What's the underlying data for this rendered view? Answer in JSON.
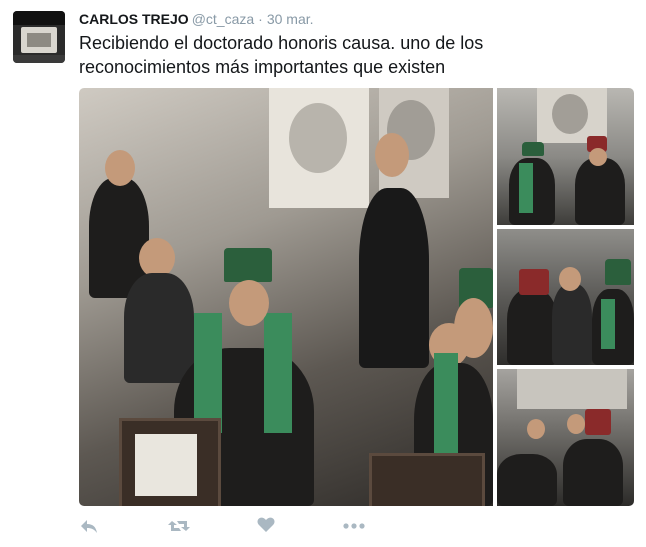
{
  "tweet": {
    "name": "CARLOS TREJO",
    "handle": "@ct_caza",
    "separator": "·",
    "date": "30 mar.",
    "text": "Recibiendo el doctorado honoris causa. uno de los reconocimientos más importantes que existen"
  },
  "media": {
    "photos": [
      {
        "icon": "photo-main"
      },
      {
        "icon": "photo-side-1"
      },
      {
        "icon": "photo-side-2"
      },
      {
        "icon": "photo-side-3"
      }
    ]
  },
  "actions": {
    "reply_icon": "reply-icon",
    "retweet_icon": "retweet-icon",
    "like_icon": "heart-icon",
    "more_icon": "more-icon",
    "icon_color": "#aab8c2"
  }
}
